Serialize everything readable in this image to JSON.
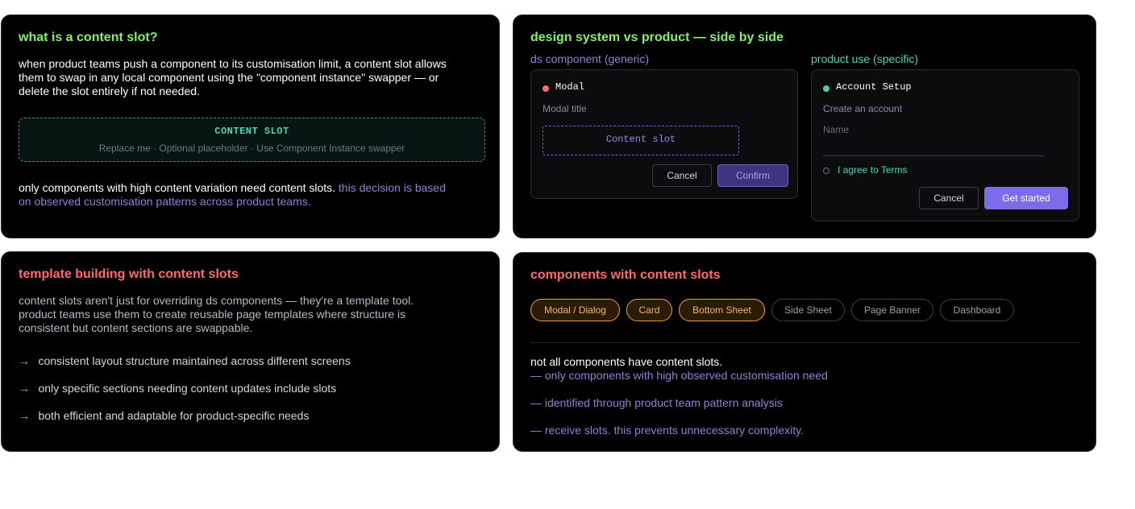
{
  "card1": {
    "title": "what is a content slot?",
    "body_lines": [
      "when product teams push a component to its customisation limit, a content slot allows",
      "them to swap in any local component using the \"component instance\" swapper — or",
      "delete the slot entirely if not needed."
    ],
    "slot_title": "CONTENT SLOT",
    "slot_subtitle": "Replace me · Optional placeholder · Use Component Instance swapper",
    "footer_line1_white": "only components with high content variation need content slots.",
    "footer_line1_muted": "this decision is based",
    "footer_line2_muted": "on observed customisation patterns across product teams."
  },
  "card2": {
    "title": "design system vs product — side by side",
    "ds_label": "ds component (generic)",
    "product_label": "product use (specific)",
    "ds": {
      "name": "Modal",
      "subtitle": "Modal title",
      "slot": "Content slot",
      "cancel": "Cancel",
      "confirm": "Confirm"
    },
    "product": {
      "name": "Account Setup",
      "subtitle": "Create an account",
      "field_label": "Name",
      "checkbox_label": "I agree to Terms",
      "cancel": "Cancel",
      "primary": "Get started"
    }
  },
  "card3": {
    "title": "template building with content slots",
    "body_lines": [
      "content slots aren't just for overriding ds components — they're a template tool.",
      "product teams use them to create reusable page templates where structure is",
      "consistent but content sections are swappable."
    ],
    "bullets": [
      "consistent layout structure maintained across different screens",
      "only specific sections needing content updates include slots",
      "both efficient and adaptable for product-specific needs"
    ],
    "arrow": "→"
  },
  "card4": {
    "title": "components with content slots",
    "chips": [
      {
        "label": "Modal / Dialog",
        "active": true
      },
      {
        "label": "Card",
        "active": true
      },
      {
        "label": "Bottom Sheet",
        "active": true
      },
      {
        "label": "Side Sheet",
        "active": false
      },
      {
        "label": "Page Banner",
        "active": false
      },
      {
        "label": "Dashboard",
        "active": false
      }
    ],
    "note_white": "not all components have content slots.",
    "note_lines": [
      "— only components with high observed customisation need",
      "— identified through product team pattern analysis",
      "— receive slots. this prevents unnecessary complexity."
    ]
  },
  "colors": {
    "green_heading": "#86ef6e",
    "red_heading": "#ff6b6b",
    "purple_text": "#8b83d6",
    "teal": "#4fd6a8",
    "accent_purple": "#7b6ce8",
    "chip_orange": "#e8a23a",
    "status_red_dot": "#ff6b6b",
    "status_green_dot": "#3fd6a0"
  }
}
